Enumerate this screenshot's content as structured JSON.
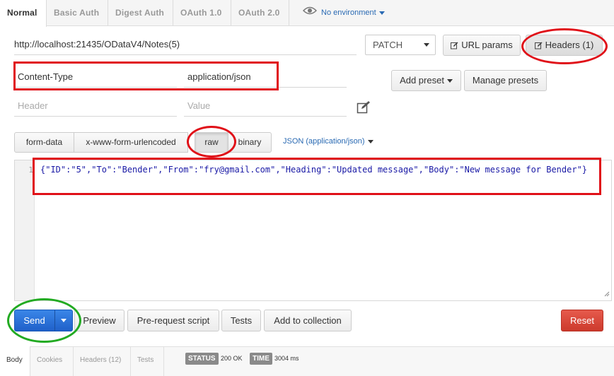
{
  "auth_tabs": [
    {
      "label": "Normal",
      "active": true
    },
    {
      "label": "Basic Auth",
      "active": false
    },
    {
      "label": "Digest Auth",
      "active": false
    },
    {
      "label": "OAuth 1.0",
      "active": false
    },
    {
      "label": "OAuth 2.0",
      "active": false
    }
  ],
  "environment": {
    "label": "No environment",
    "icon": "eye-icon"
  },
  "request": {
    "url": "http://localhost:21435/ODataV4/Notes(5)",
    "method": "PATCH",
    "url_params_label": "URL params",
    "headers_label": "Headers (1)"
  },
  "headers": {
    "key": "Content-Type",
    "value": "application/json",
    "key_placeholder": "Header",
    "value_placeholder": "Value",
    "add_preset_label": "Add preset",
    "manage_presets_label": "Manage presets"
  },
  "body_tabs": [
    {
      "label": "form-data",
      "active": false
    },
    {
      "label": "x-www-form-urlencoded",
      "active": false
    },
    {
      "label": "raw",
      "active": true
    },
    {
      "label": "binary",
      "active": false
    }
  ],
  "body_mode": "JSON (application/json)",
  "editor": {
    "line_number": "1",
    "code": "{\"ID\":\"5\",\"To\":\"Bender\",\"From\":\"fry@gmail.com\",\"Heading\":\"Updated message\",\"Body\":\"New message for Bender\"}"
  },
  "actions": {
    "send_label": "Send",
    "preview_label": "Preview",
    "prerequest_label": "Pre-request script",
    "tests_label": "Tests",
    "add_collection_label": "Add to collection",
    "reset_label": "Reset"
  },
  "response": {
    "tabs": [
      {
        "label": "Body",
        "active": true
      },
      {
        "label": "Cookies",
        "active": false
      },
      {
        "label": "Headers (12)",
        "active": false
      },
      {
        "label": "Tests",
        "active": false
      }
    ],
    "status_label": "STATUS",
    "status_value": "200 OK",
    "time_label": "TIME",
    "time_value": "3004 ms"
  },
  "colors": {
    "send": "#1f60c9",
    "reset": "#cc3a2c",
    "annotation_red": "#e01018",
    "annotation_green": "#22aa22",
    "link_blue": "#2a6ab3"
  }
}
